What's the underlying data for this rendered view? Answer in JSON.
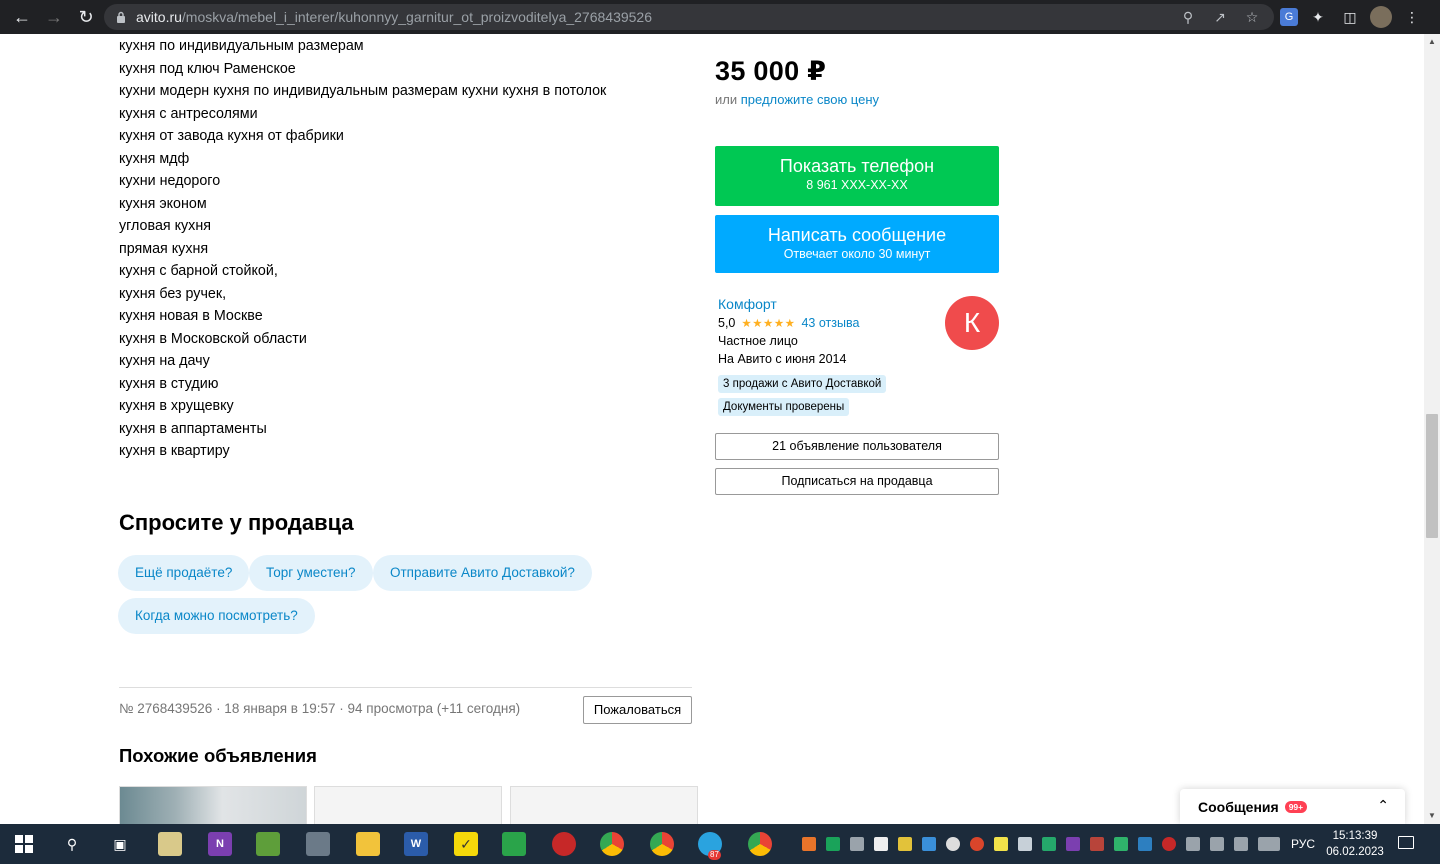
{
  "browser": {
    "url_host": "avito.ru",
    "url_path": "/moskva/mebel_i_interer/kuhonnyy_garnitur_ot_proizvoditelya_2768439526"
  },
  "keywords": [
    "кухня по индивидуальным размерам",
    "кухня под ключ Раменское",
    "кухни модерн кухня по индивидуальным размерам кухни кухня в потолок",
    "кухня с антресолями",
    "кухня от завода кухня от фабрики",
    "кухня мдф",
    "кухни недорого",
    "кухня эконом",
    "угловая кухня",
    "прямая кухня",
    "кухня с барной стойкой,",
    "кухня без ручек,",
    "кухня новая в Москве",
    "кухня в Московской области",
    "кухня на дачу",
    "кухня в студию",
    "кухня в хрущевку",
    "кухня в аппартаменты",
    "кухня в квартиру"
  ],
  "ask_seller": {
    "title": "Спросите у продавца",
    "chips": [
      "Ещё продаёте?",
      "Торг уместен?",
      "Отправите Авито Доставкой?",
      "Когда можно посмотреть?"
    ]
  },
  "listing_meta": {
    "text": "№ 2768439526 · 18 января в 19:57 · 94 просмотра (+11 сегодня)",
    "report_label": "Пожаловаться"
  },
  "similar": {
    "title": "Похожие объявления"
  },
  "sidebar": {
    "price": "35 000 ₽",
    "offer_prefix": "или",
    "offer_link": "предложите свою цену",
    "phone_button": {
      "label": "Показать телефон",
      "sub": "8 961 XXX-XX-XX"
    },
    "message_button": {
      "label": "Написать сообщение",
      "sub": "Отвечает около 30 минут"
    },
    "seller": {
      "name": "Комфорт",
      "rating": "5,0",
      "stars": "★★★★★",
      "reviews": "43 отзыва",
      "type": "Частное лицо",
      "since": "На Авито с июня 2014",
      "badges": [
        "3 продажи с Авито Доставкой",
        "Документы проверены"
      ],
      "avatar_letter": "К"
    },
    "user_ads_button": "21 объявление пользователя",
    "subscribe_button": "Подписаться на продавца"
  },
  "messages_panel": {
    "label": "Сообщения",
    "count": "99+"
  },
  "taskbar": {
    "lang": "РУС",
    "time": "15:13:39",
    "date": "06.02.2023",
    "telegram_badge": "87"
  },
  "colors": {
    "green": "#00c853",
    "blue": "#00aaff",
    "link": "#0a87c8",
    "avatar": "#f04b4c"
  }
}
